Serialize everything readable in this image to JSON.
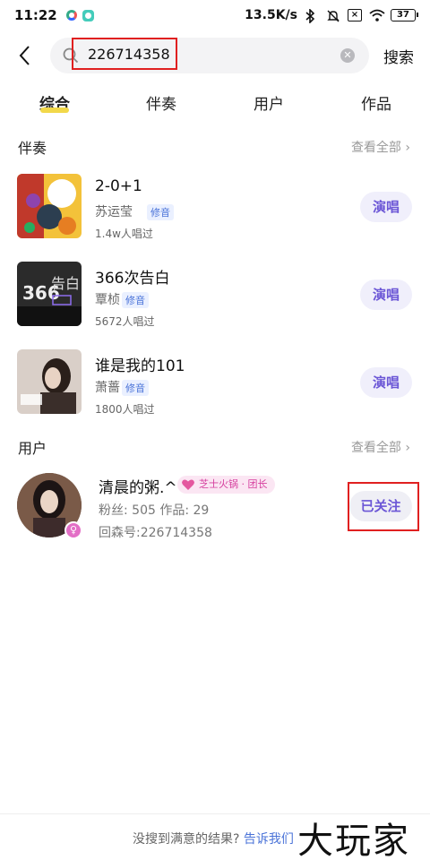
{
  "status_bar": {
    "time": "11:22",
    "network_speed": "13.5K/s",
    "battery": "37"
  },
  "search": {
    "query": "226714358",
    "search_button": "搜索"
  },
  "tabs": [
    {
      "label": "综合",
      "active": true
    },
    {
      "label": "伴奏",
      "active": false
    },
    {
      "label": "用户",
      "active": false
    },
    {
      "label": "作品",
      "active": false
    }
  ],
  "accompaniment_section": {
    "title": "伴奏",
    "see_all": "查看全部",
    "items": [
      {
        "title": "2-0+1",
        "artist": "苏运莹",
        "tag": "修音",
        "count": "1.4w人唱过",
        "action": "演唱"
      },
      {
        "title": "366次告白",
        "artist": "覃桢",
        "tag": "修音",
        "count": "5672人唱过",
        "action": "演唱"
      },
      {
        "title": "谁是我的101",
        "artist": "萧蔷",
        "tag": "修音",
        "count": "1800人唱过",
        "action": "演唱"
      }
    ]
  },
  "user_section": {
    "title": "用户",
    "see_all": "查看全部",
    "user": {
      "name": "清晨的粥.^",
      "badge": "芝士火锅 · 团长",
      "stats": "粉丝: 505 作品: 29",
      "id_line": "回森号:226714358",
      "follow_state": "已关注"
    }
  },
  "footer": {
    "prompt": "没搜到满意的结果?",
    "link": "告诉我们",
    "watermark": "大玩家"
  },
  "colors": {
    "accent_purple": "#6b56d6",
    "tab_underline": "#f2d84a",
    "tag_blue": "#4a73d8",
    "highlight_red": "#e02020"
  }
}
